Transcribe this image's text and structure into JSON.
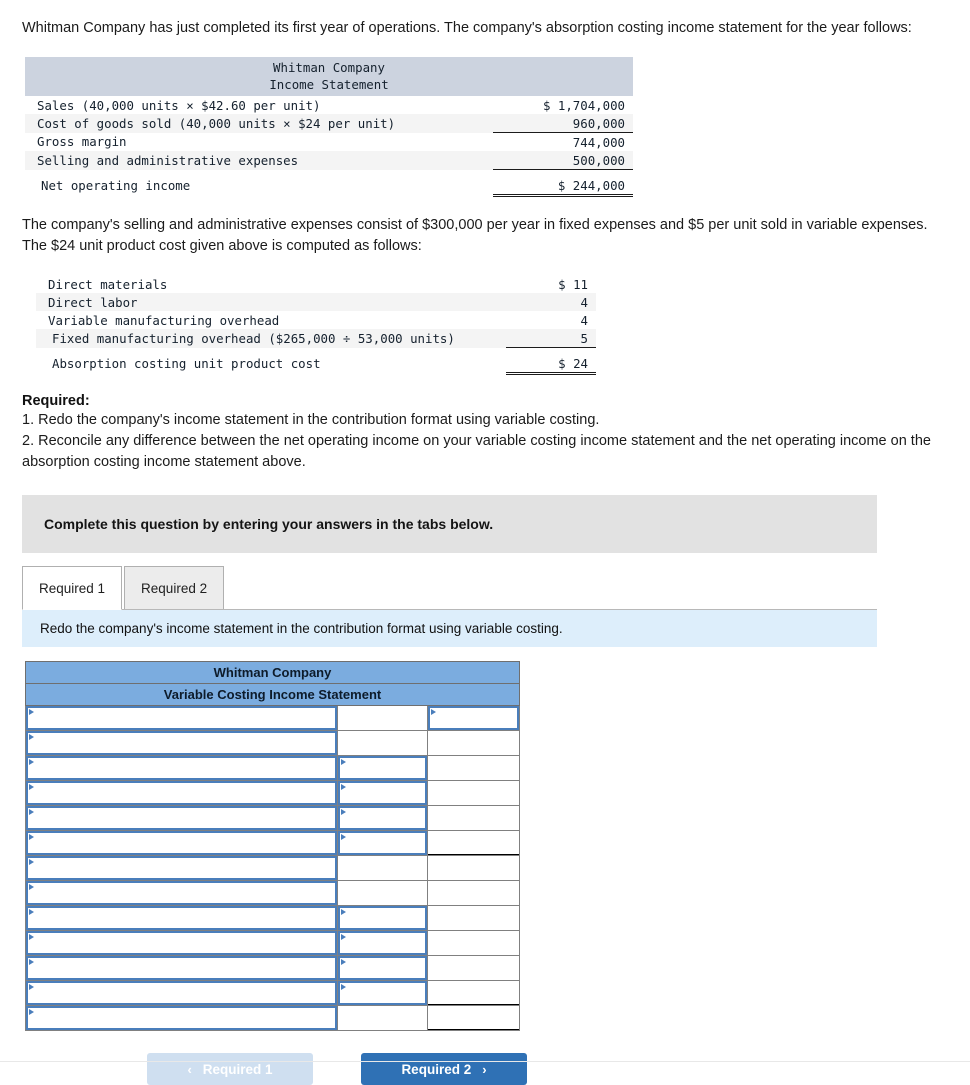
{
  "intro": {
    "paragraph": "Whitman Company has just completed its first year of operations. The company's absorption costing income statement for the year follows:"
  },
  "income_statement": {
    "company": "Whitman Company",
    "subtitle": "Income Statement",
    "rows": [
      {
        "label": "Sales (40,000 units × $42.60 per unit)",
        "value": "$ 1,704,000"
      },
      {
        "label": "Cost of goods sold (40,000 units × $24 per unit)",
        "value": "960,000"
      },
      {
        "label": "Gross margin",
        "value": "744,000"
      },
      {
        "label": "Selling and administrative expenses",
        "value": "500,000"
      },
      {
        "label": "Net operating income",
        "value": "$ 244,000"
      }
    ]
  },
  "middle": {
    "paragraph": "The company's selling and administrative expenses consist of $300,000 per year in fixed expenses and $5 per unit sold in variable expenses. The $24 unit product cost given above is computed as follows:"
  },
  "unit_cost": {
    "rows": [
      {
        "label": "Direct materials",
        "value": "$ 11"
      },
      {
        "label": "Direct labor",
        "value": "4"
      },
      {
        "label": "Variable manufacturing overhead",
        "value": "4"
      },
      {
        "label": "Fixed manufacturing overhead ($265,000 ÷ 53,000 units)",
        "value": "5"
      },
      {
        "label": "Absorption costing unit product cost",
        "value": "$ 24"
      }
    ]
  },
  "required": {
    "heading": "Required:",
    "items": [
      "1. Redo the company's income statement in the contribution format using variable costing.",
      "2. Reconcile any difference between the net operating income on your variable costing income statement and the net operating income on the absorption costing income statement above."
    ]
  },
  "banner": {
    "text": "Complete this question by entering your answers in the tabs below."
  },
  "tabs": [
    {
      "label": "Required 1",
      "active": true
    },
    {
      "label": "Required 2",
      "active": false
    }
  ],
  "tab_instruction": {
    "text": "Redo the company's income statement in the contribution format using variable costing."
  },
  "answer_table": {
    "title": "Whitman Company",
    "subtitle": "Variable Costing Income Statement",
    "rows": [
      {
        "label": "",
        "amount": "",
        "total": "",
        "label_input": true,
        "amount_input": false,
        "total_input": true,
        "rule_after": "none"
      },
      {
        "label": "",
        "amount": "",
        "total": "",
        "label_input": true,
        "amount_input": false,
        "total_input": false,
        "rule_after": "none"
      },
      {
        "label": "",
        "amount": "",
        "total": "",
        "label_input": true,
        "amount_input": true,
        "total_input": false,
        "rule_after": "none"
      },
      {
        "label": "",
        "amount": "",
        "total": "",
        "label_input": true,
        "amount_input": true,
        "total_input": false,
        "rule_after": "none"
      },
      {
        "label": "",
        "amount": "",
        "total": "",
        "label_input": true,
        "amount_input": true,
        "total_input": false,
        "rule_after": "none"
      },
      {
        "label": "",
        "amount": "",
        "total": "",
        "label_input": true,
        "amount_input": true,
        "total_input": false,
        "rule_after": "single"
      },
      {
        "label": "",
        "amount": "",
        "total": "",
        "label_input": true,
        "amount_input": false,
        "total_input": false,
        "rule_after": "none"
      },
      {
        "label": "",
        "amount": "",
        "total": "",
        "label_input": true,
        "amount_input": false,
        "total_input": false,
        "rule_after": "none"
      },
      {
        "label": "",
        "amount": "",
        "total": "",
        "label_input": true,
        "amount_input": true,
        "total_input": false,
        "rule_after": "none"
      },
      {
        "label": "",
        "amount": "",
        "total": "",
        "label_input": true,
        "amount_input": true,
        "total_input": false,
        "rule_after": "none"
      },
      {
        "label": "",
        "amount": "",
        "total": "",
        "label_input": true,
        "amount_input": true,
        "total_input": false,
        "rule_after": "none"
      },
      {
        "label": "",
        "amount": "",
        "total": "",
        "label_input": true,
        "amount_input": true,
        "total_input": false,
        "rule_after": "single"
      },
      {
        "label": "",
        "amount": "",
        "total": "",
        "label_input": true,
        "amount_input": false,
        "total_input": false,
        "rule_after": "double"
      }
    ]
  },
  "nav": {
    "prev_label": "Required 1",
    "prev_chevron": "‹",
    "next_label": "Required 2",
    "next_chevron": "›"
  },
  "colors": {
    "header_blue": "#7bacdf",
    "input_border": "#4a7ebb",
    "banner_grey": "#e2e2e2",
    "strip_blue": "#ddeefb",
    "btn_next": "#2f71b5",
    "btn_prev": "#cfdff0",
    "fin_header": "#ccd3df"
  }
}
